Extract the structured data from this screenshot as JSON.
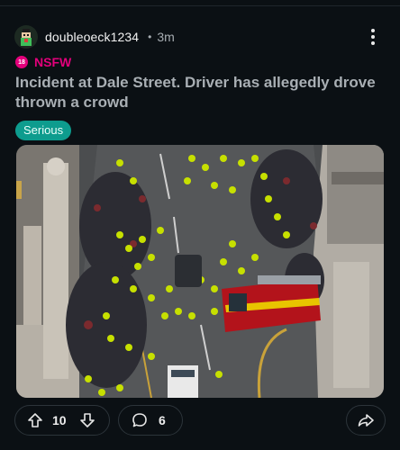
{
  "post": {
    "author": "doubleoeck1234",
    "separator": "•",
    "time": "3m",
    "nsfw_badge": "18",
    "nsfw_label": "NSFW",
    "title": "Incident at Dale Street. Driver has allegedly drove thrown a crowd",
    "flair": "Serious"
  },
  "actions": {
    "upvotes": "10",
    "comments": "6"
  },
  "icons": {
    "more": "more-vertical-icon",
    "upvote": "arrow-up-icon",
    "downvote": "arrow-down-icon",
    "comment": "comment-bubble-icon",
    "share": "share-arrow-icon"
  },
  "colors": {
    "background": "#0b1014",
    "nsfw": "#e3007b",
    "flair": "#0d9c8e",
    "title": "#a9afb4"
  }
}
